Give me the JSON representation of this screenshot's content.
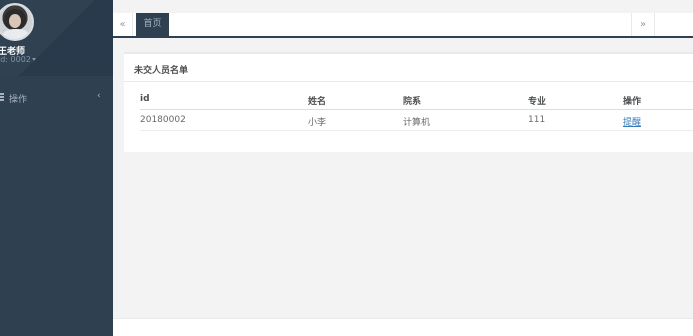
{
  "profile": {
    "name": "王老师",
    "role": "id: 0002"
  },
  "sidebar": {
    "items": [
      {
        "label": "操作",
        "icon": "list-icon",
        "arrow": "‹"
      }
    ]
  },
  "tabs": {
    "prev": "«",
    "active": "首页",
    "next": "»"
  },
  "panel": {
    "title": "未交人员名单",
    "columns": [
      "id",
      "姓名",
      "院系",
      "专业",
      "操作"
    ],
    "rows": [
      {
        "id": "20180002",
        "name": "小李",
        "department": "计算机",
        "major": "111",
        "action": "提醒"
      }
    ]
  },
  "colors": {
    "sidebar": "#2f4050",
    "link": "#337ab7",
    "background": "#f3f3f4"
  }
}
